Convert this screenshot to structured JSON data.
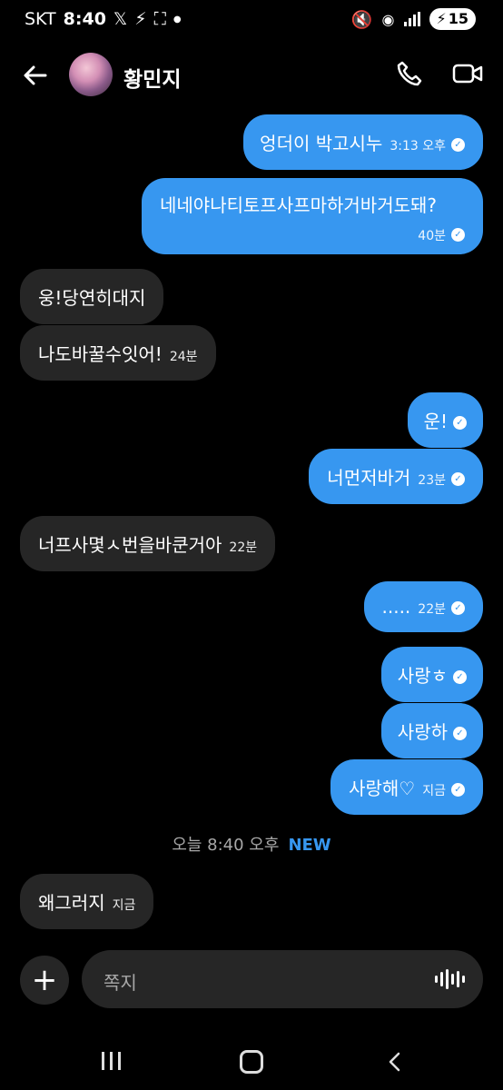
{
  "status_bar": {
    "carrier": "SKT",
    "time": "8:40",
    "battery": "15"
  },
  "header": {
    "contact_name": "황민지"
  },
  "messages": [
    {
      "text": "엉더이 박고시누",
      "time": "3:13 오후"
    },
    {
      "text": "네네야나티토프사프마하거바거도돼?",
      "time": "40분"
    },
    {
      "text": "웅!당연히대지",
      "time": ""
    },
    {
      "text": "나도바꿀수잇어!",
      "time": "24분"
    },
    {
      "text": "운!",
      "time": ""
    },
    {
      "text": "너먼저바거",
      "time": "23분"
    },
    {
      "text": "너프사몇ㅅ번을바쿤거아",
      "time": "22분"
    },
    {
      "text": ".....",
      "time": "22분"
    },
    {
      "text": "사랑ㅎ",
      "time": ""
    },
    {
      "text": "사랑하",
      "time": ""
    },
    {
      "text": "사랑해♡",
      "time": "지금"
    },
    {
      "text": "왜그러지",
      "time": "지금"
    }
  ],
  "divider": {
    "text": "오늘 8:40 오후",
    "badge": "NEW"
  },
  "composer": {
    "placeholder": "쪽지"
  },
  "colors": {
    "outgoing_bubble": "#3797f0",
    "incoming_bubble": "#262626",
    "background": "#000000"
  }
}
